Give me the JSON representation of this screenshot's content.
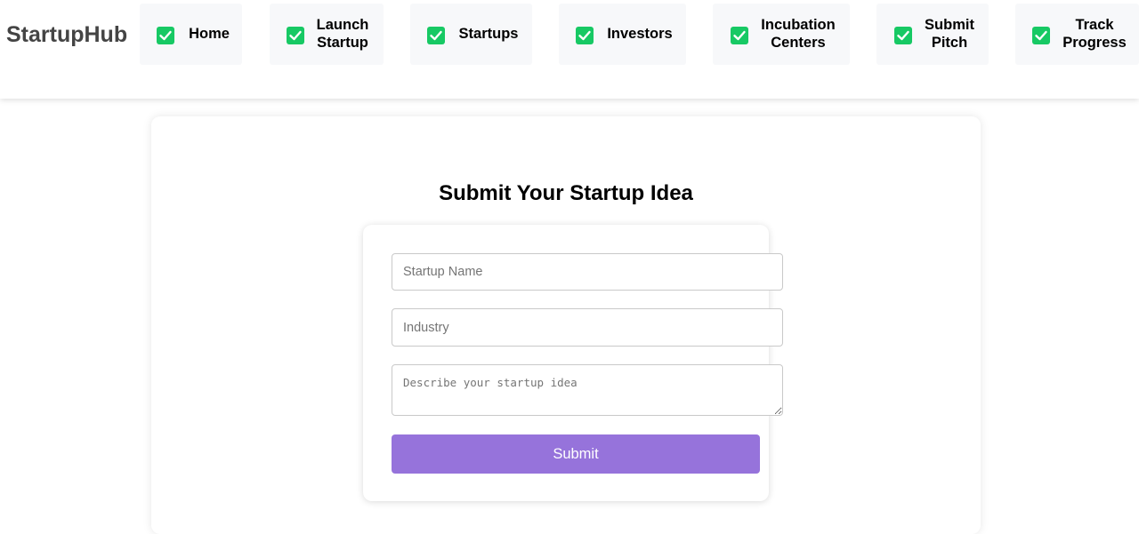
{
  "brand": {
    "name": "StartupHub"
  },
  "nav": {
    "items": [
      {
        "label": "Home",
        "icon": "check-icon"
      },
      {
        "label": "Launch\nStartup",
        "icon": "check-icon"
      },
      {
        "label": "Startups",
        "icon": "check-icon"
      },
      {
        "label": "Investors",
        "icon": "check-icon"
      },
      {
        "label": "Incubation\nCenters",
        "icon": "check-icon"
      },
      {
        "label": "Submit\nPitch",
        "icon": "check-icon"
      },
      {
        "label": "Track\nProgress",
        "icon": "check-icon"
      }
    ]
  },
  "form": {
    "title": "Submit Your Startup Idea",
    "startup_name_placeholder": "Startup Name",
    "industry_placeholder": "Industry",
    "description_placeholder": "Describe your startup idea",
    "submit_label": "Submit"
  },
  "colors": {
    "check_green": "#17c964",
    "submit_purple": "#9673db",
    "nav_bg": "#f7f8fa",
    "logo_text": "#444444"
  }
}
